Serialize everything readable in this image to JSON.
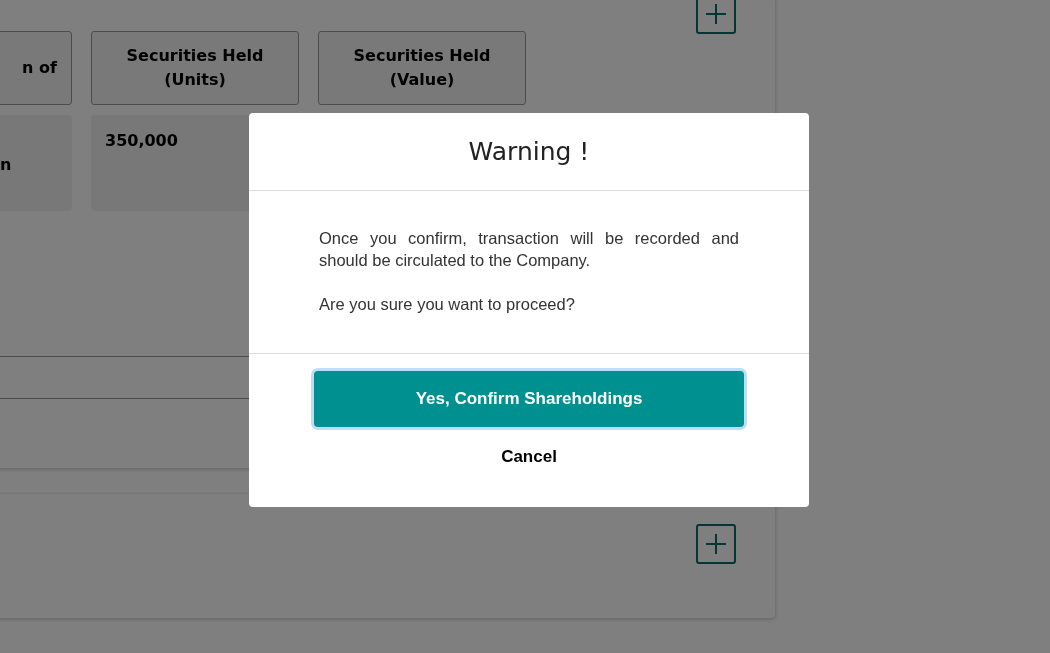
{
  "background": {
    "columns": [
      {
        "heading": "n of",
        "cell": "n"
      },
      {
        "heading": "Securities Held (Units)",
        "cell": "350,000"
      },
      {
        "heading": "Securities Held (Value)"
      }
    ]
  },
  "dialog": {
    "title": "Warning !",
    "message": "Once you confirm, transaction will be recorded and should be circulated to the Company.",
    "question": "Are you sure you want to proceed?",
    "confirm_button": "Yes, Confirm Shareholdings",
    "cancel_button": "Cancel"
  }
}
